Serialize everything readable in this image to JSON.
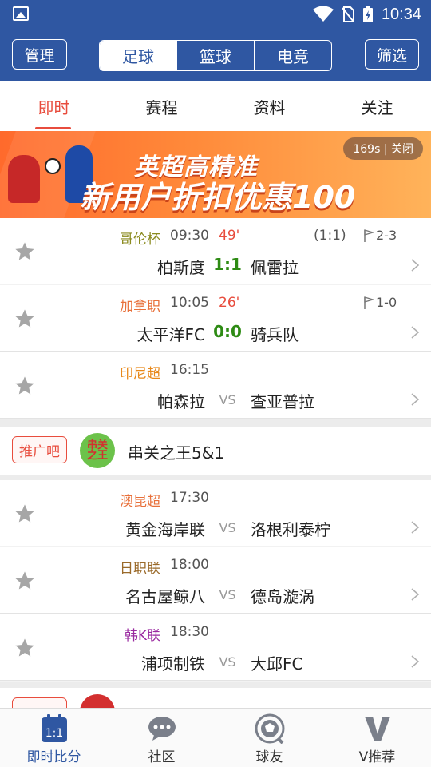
{
  "status_bar": {
    "time": "10:34"
  },
  "header": {
    "manage_label": "管理",
    "filter_label": "筛选",
    "sports": [
      {
        "label": "足球",
        "active": true
      },
      {
        "label": "篮球",
        "active": false
      },
      {
        "label": "电竞",
        "active": false
      }
    ]
  },
  "tabs": [
    {
      "label": "即时",
      "active": true
    },
    {
      "label": "赛程",
      "active": false
    },
    {
      "label": "资料",
      "active": false
    },
    {
      "label": "关注",
      "active": false
    }
  ],
  "banner": {
    "headline": "英超高精准",
    "subline": "新用户折扣优惠100",
    "countdown_close": "169s | 关闭"
  },
  "matches": [
    {
      "league": "哥伦杯",
      "league_color": "#8a8a1e",
      "time": "09:30",
      "minute": "49'",
      "half_score": "(1:1)",
      "corner": "2-3",
      "home": "柏斯度",
      "score": "1:1",
      "away": "佩雷拉"
    },
    {
      "league": "加拿职",
      "league_color": "#e8703a",
      "time": "10:05",
      "minute": "26'",
      "half_score": "",
      "corner": "1-0",
      "home": "太平洋FC",
      "score": "0:0",
      "away": "骑兵队"
    },
    {
      "league": "印尼超",
      "league_color": "#e8881a",
      "time": "16:15",
      "minute": "",
      "half_score": "",
      "corner": "",
      "home": "帕森拉",
      "score": "VS",
      "away": "查亚普拉"
    },
    {
      "league": "澳昆超",
      "league_color": "#e8703a",
      "time": "17:30",
      "minute": "",
      "half_score": "",
      "corner": "",
      "home": "黄金海岸联",
      "score": "VS",
      "away": "洛根利泰柠"
    },
    {
      "league": "日职联",
      "league_color": "#9a6a2a",
      "time": "18:00",
      "minute": "",
      "half_score": "",
      "corner": "",
      "home": "名古屋鲸八",
      "score": "VS",
      "away": "德岛漩涡"
    },
    {
      "league": "韩K联",
      "league_color": "#9a2aa0",
      "time": "18:30",
      "minute": "",
      "half_score": "",
      "corner": "",
      "home": "浦项制铁",
      "score": "VS",
      "away": "大邱FC"
    }
  ],
  "promo": {
    "badge": "推广吧",
    "logo_text": "串关之王",
    "title": "串关之王5&1"
  },
  "bottom_nav": [
    {
      "label": "即时比分",
      "icon": "scoreboard-icon",
      "active": true
    },
    {
      "label": "社区",
      "icon": "chat-bubble-icon",
      "active": false
    },
    {
      "label": "球友",
      "icon": "soccer-ball-icon",
      "active": false
    },
    {
      "label": "V推荐",
      "icon": "v-letter-icon",
      "active": false
    }
  ]
}
